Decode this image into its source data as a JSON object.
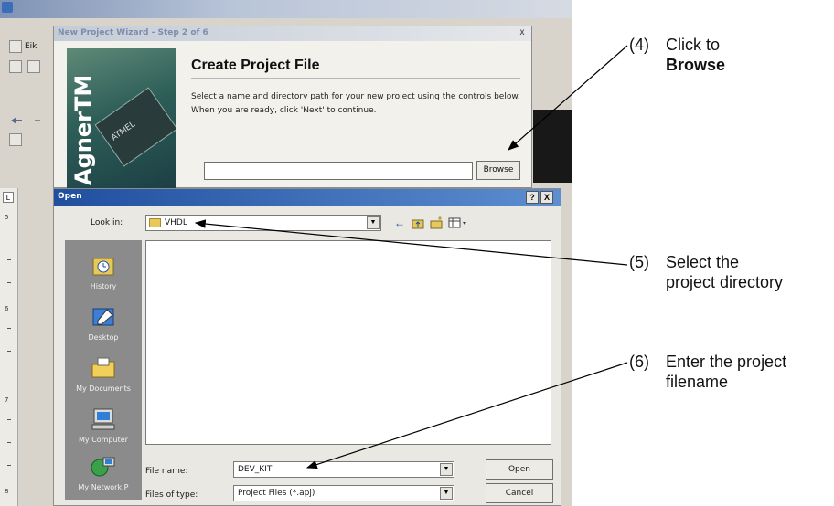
{
  "wizard": {
    "title": "New Project Wizard - Step 2 of 6",
    "close_label": "x",
    "heading": "Create Project File",
    "description": "Select a name and directory path for your new project using the controls below. When you are ready, click 'Next' to continue.",
    "browse_label": "Browse",
    "brand_text": "AgnerTM",
    "chip_text": "ATMEL"
  },
  "app": {
    "menu_first": "Eik"
  },
  "ruler": {
    "corner_label": "L",
    "marks": [
      "5",
      "6",
      "7",
      "8"
    ]
  },
  "open_dialog": {
    "title": "Open",
    "help_label": "?",
    "close_label": "X",
    "look_in_label": "Look in:",
    "look_in_value": "VHDL",
    "places": [
      {
        "label": "History",
        "icon": "history-icon"
      },
      {
        "label": "Desktop",
        "icon": "desktop-icon"
      },
      {
        "label": "My Documents",
        "icon": "my-documents-icon"
      },
      {
        "label": "My Computer",
        "icon": "my-computer-icon"
      },
      {
        "label": "My Network P",
        "icon": "my-network-places-icon"
      }
    ],
    "file_name_label": "File name:",
    "file_name_value": "DEV_KIT",
    "file_type_label": "Files of type:",
    "file_type_value": "Project Files (*.apj)",
    "open_label": "Open",
    "cancel_label": "Cancel"
  },
  "annotations": [
    {
      "number": "(4)",
      "line1": "Click to",
      "line2": "Browse"
    },
    {
      "number": "(5)",
      "line1": "Select the",
      "line2": "project directory"
    },
    {
      "number": "(6)",
      "line1": "Enter the project",
      "line2": "filename"
    }
  ],
  "colors": {
    "dialog_titlebar": "#1f4f9e",
    "places_bar": "#8b8b8b",
    "annotation_text": "#111111"
  }
}
